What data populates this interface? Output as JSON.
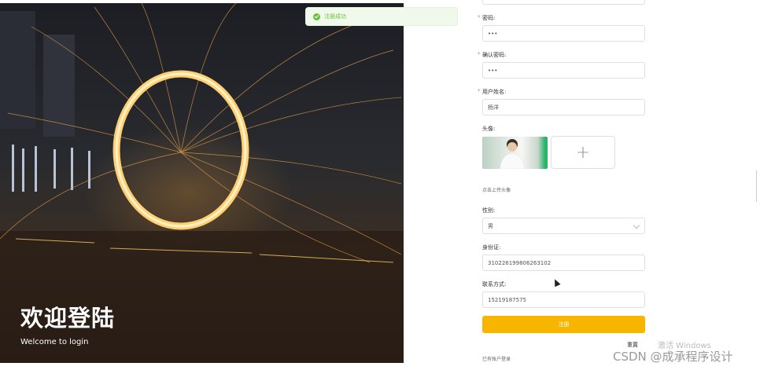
{
  "hero": {
    "title": "欢迎登陆",
    "subtitle": "Welcome to login"
  },
  "toast": {
    "text": "注册成功",
    "icon": "check-circle-icon",
    "color": "#67c23a"
  },
  "form": {
    "password_label": "密码:",
    "password_value": "•••",
    "confirm_label": "确认密码:",
    "confirm_value": "•••",
    "name_label": "用户姓名:",
    "name_value": "杨洋",
    "avatar_label": "头像:",
    "avatar_hint": "点击上传头像",
    "gender_label": "性别:",
    "gender_value": "男",
    "id_label": "身份证:",
    "id_value": "310226199806263102",
    "phone_label": "联系方式:",
    "phone_value": "15219187575",
    "register_button": "注册",
    "reset_button": "重置",
    "login_link": "已有账户登录",
    "required_mark": "*"
  },
  "overlay": {
    "windows_activation": "激活 Windows",
    "watermark": "CSDN @成承程序设计"
  },
  "colors": {
    "primary": "#f7b500",
    "border": "#dcdfe6",
    "required": "#f56c6c"
  }
}
